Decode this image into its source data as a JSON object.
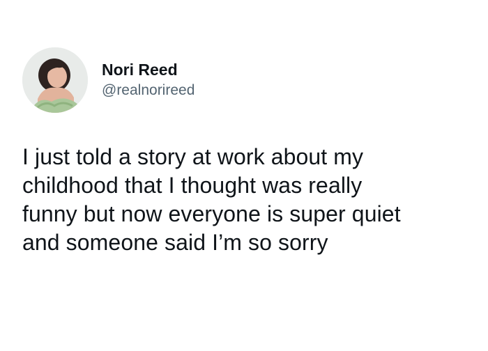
{
  "author": {
    "display_name": "Nori Reed",
    "handle": "@realnorireed",
    "avatar_icon": "profile-photo"
  },
  "tweet": {
    "text": "I just told a story at work about my\nchildhood that I thought was really\nfunny but now everyone is super quiet\nand someone said I’m so sorry"
  },
  "colors": {
    "text_primary": "#0f1419",
    "text_secondary": "#536471",
    "background": "#ffffff"
  }
}
